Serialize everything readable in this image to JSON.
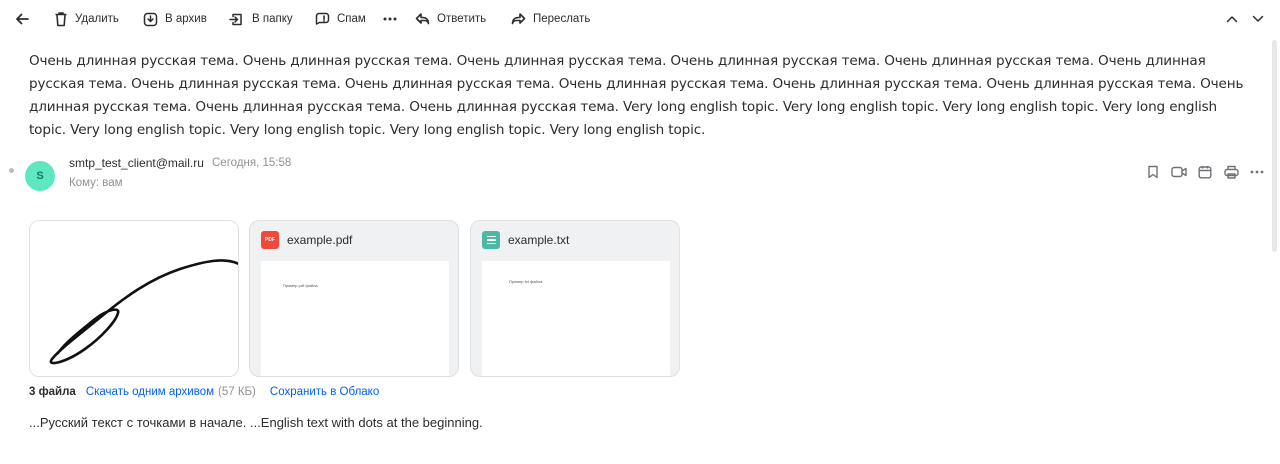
{
  "toolbar": {
    "back_icon": "arrow-left-icon",
    "delete_label": "Удалить",
    "archive_label": "В архив",
    "folder_label": "В папку",
    "spam_label": "Спам",
    "more_icon": "more-horizontal-icon",
    "reply_label": "Ответить",
    "forward_label": "Переслать",
    "prev_icon": "chevron-up-icon",
    "next_icon": "chevron-down-icon"
  },
  "subject": "Очень длинная русская тема. Очень длинная русская тема. Очень длинная русская тема. Очень длинная русская тема. Очень длинная русская тема. Очень длинная русская тема. Очень длинная русская тема. Очень длинная русская тема. Очень длинная русская тема. Очень длинная русская тема. Очень длинная русская тема. Очень длинная русская тема. Очень длинная русская тема. Очень длинная русская тема. Very long english topic. Very long english topic. Very long english topic. Very long english topic. Very long english topic. Very long english topic. Very long english topic. Very long english topic.",
  "sender": {
    "avatar_letter": "S",
    "avatar_color": "#5ee7c0",
    "email": "smtp_test_client@mail.ru",
    "date": "Сегодня, 15:58",
    "recipient": "Кому: вам"
  },
  "message_actions": [
    "bookmark-icon",
    "video-icon",
    "calendar-icon",
    "print-icon",
    "more-horizontal-icon"
  ],
  "attachments": [
    {
      "name": "",
      "type": "image",
      "icon": "image-icon"
    },
    {
      "name": "example.pdf",
      "type": "pdf",
      "badge": "PDF",
      "preview_text": "Пример pdf файла"
    },
    {
      "name": "example.txt",
      "type": "txt",
      "preview_text": "Пример txt файла"
    }
  ],
  "files_bar": {
    "count": "3 файла",
    "download_link": "Скачать одним архивом",
    "size": "(57 КБ)",
    "save_link": "Сохранить в Облако"
  },
  "body_text": "...Русский текст с точками в начале. ...English text with dots at the beginning.",
  "colors": {
    "link": "#005ff9",
    "muted": "#8f9194",
    "text": "#2c2d2e",
    "pdf_badge": "#ee4a3c",
    "txt_badge": "#4fb8a4"
  }
}
